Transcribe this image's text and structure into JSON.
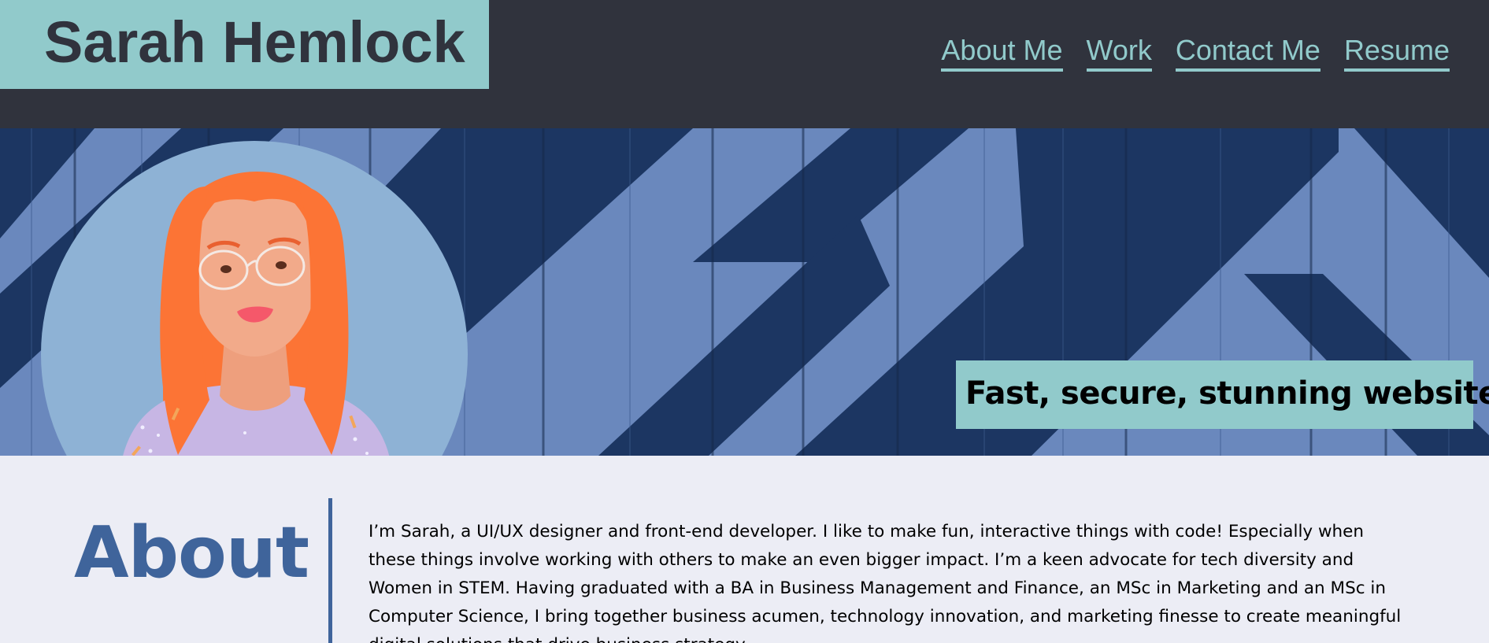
{
  "header": {
    "name": "Sarah Hemlock",
    "nav": [
      {
        "label": "About Me"
      },
      {
        "label": "Work"
      },
      {
        "label": "Contact Me"
      },
      {
        "label": "Resume"
      }
    ]
  },
  "hero": {
    "tagline": "Fast, secure, stunning websites!"
  },
  "about": {
    "title": "About",
    "text": "I’m Sarah, a UI/UX designer and front-end developer. I like to make fun, interactive things with code! Especially when these things involve working with others to make an even bigger impact. I’m a keen advocate for tech diversity and Women in STEM. Having graduated with a BA in Business Management and Finance, an MSc in Marketing and an MSc in Computer Science, I bring together business acumen, technology innovation, and marketing finesse to create meaningful digital solutions that drive business strategy."
  },
  "colors": {
    "header_bg": "#30333D",
    "accent": "#91CACB",
    "hero_dark": "#1C3662",
    "hero_light": "#6A88BD",
    "about_bg": "#ECEDF5",
    "about_title": "#3F649B"
  }
}
